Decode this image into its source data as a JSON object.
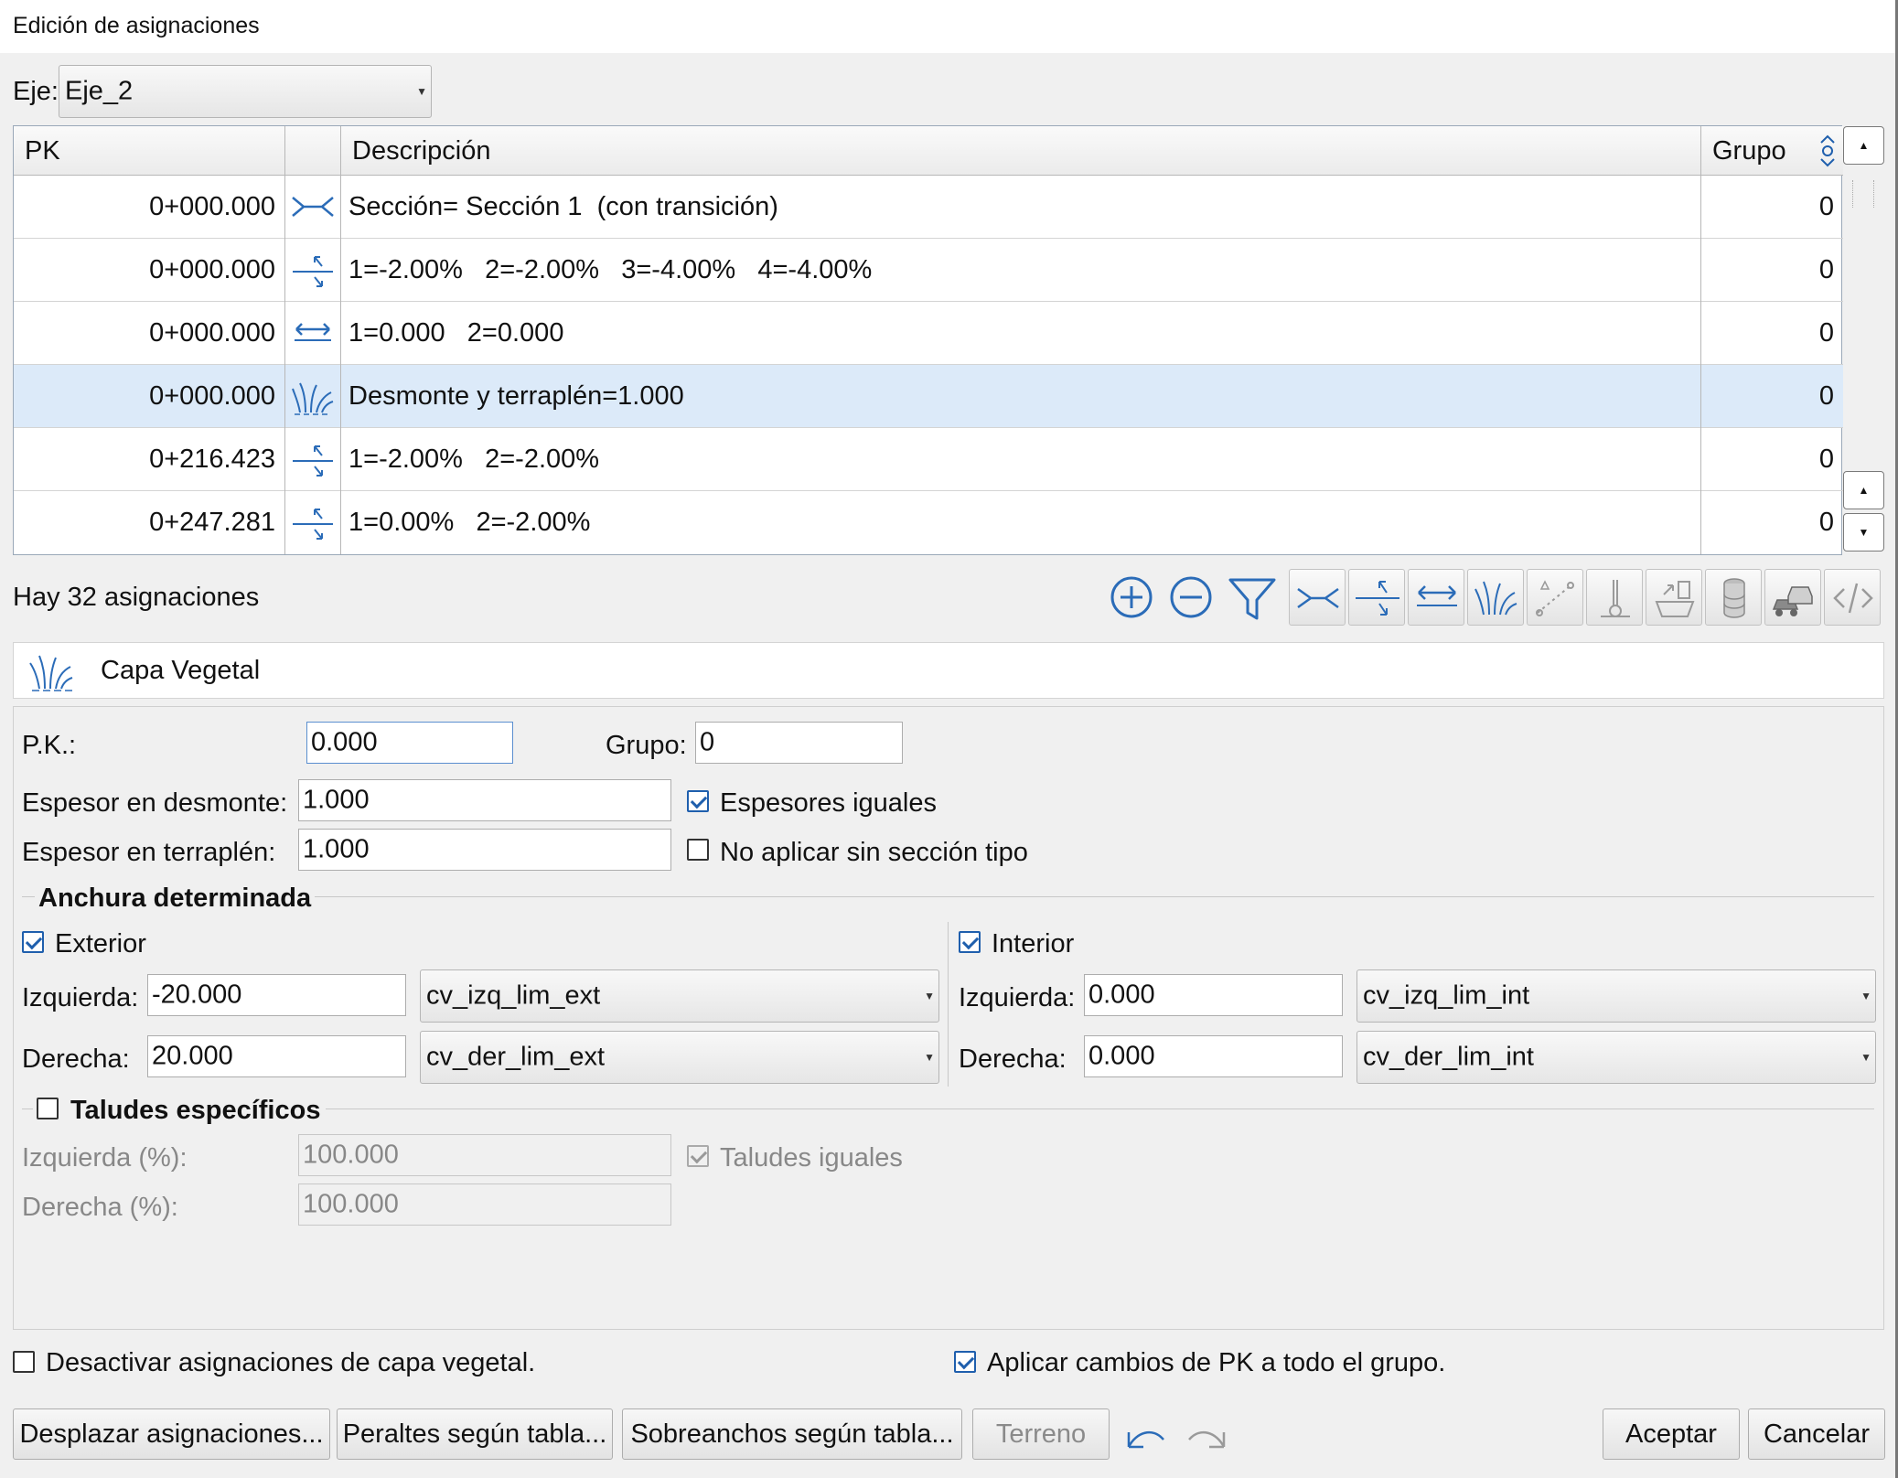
{
  "window": {
    "title": "Edición de asignaciones"
  },
  "axis": {
    "label": "Eje:",
    "value": "Eje_2"
  },
  "table": {
    "headers": {
      "pk": "PK",
      "icon": "",
      "description": "Descripción",
      "group": "Grupo"
    },
    "rows": [
      {
        "pk": "0+000.000",
        "icon": "section-icon",
        "description": "Sección= Sección 1  (con transición)",
        "group": "0"
      },
      {
        "pk": "0+000.000",
        "icon": "superelevation-icon",
        "description": "1=-2.00%   2=-2.00%   3=-4.00%   4=-4.00%",
        "group": "0"
      },
      {
        "pk": "0+000.000",
        "icon": "widening-icon",
        "description": "1=0.000   2=0.000",
        "group": "0"
      },
      {
        "pk": "0+000.000",
        "icon": "vegetation-icon",
        "description": "Desmonte y terraplén=1.000",
        "group": "0",
        "selected": true
      },
      {
        "pk": "0+216.423",
        "icon": "superelevation-icon",
        "description": "1=-2.00%   2=-2.00%",
        "group": "0"
      },
      {
        "pk": "0+247.281",
        "icon": "superelevation-icon",
        "description": "1=0.00%   2=-2.00%",
        "group": "0"
      }
    ]
  },
  "count_text": "Hay 32 asignaciones",
  "toolbar_icons": [
    "add-icon",
    "remove-icon",
    "filter-icon",
    "section-icon",
    "superelevation-icon",
    "widening-icon",
    "vegetation-icon",
    "slope-icon",
    "thermometer-icon",
    "demolition-icon",
    "cylinder-icon",
    "traffic-icon",
    "code-icon"
  ],
  "panel": {
    "title": "Capa Vegetal",
    "pk_label": "P.K.:",
    "pk_value": "0.000",
    "group_label": "Grupo:",
    "group_value": "0",
    "cut_label": "Espesor en desmonte:",
    "cut_value": "1.000",
    "fill_label": "Espesor en terraplén:",
    "fill_value": "1.000",
    "equal_thickness": {
      "label": "Espesores iguales",
      "checked": true
    },
    "no_apply": {
      "label": "No aplicar sin sección tipo",
      "checked": false
    },
    "width_section": "Anchura determinada",
    "exterior": {
      "label": "Exterior",
      "checked": true,
      "left_label": "Izquierda:",
      "left_value": "-20.000",
      "left_combo": "cv_izq_lim_ext",
      "right_label": "Derecha:",
      "right_value": "20.000",
      "right_combo": "cv_der_lim_ext"
    },
    "interior": {
      "label": "Interior",
      "checked": true,
      "left_label": "Izquierda:",
      "left_value": "0.000",
      "left_combo": "cv_izq_lim_int",
      "right_label": "Derecha:",
      "right_value": "0.000",
      "right_combo": "cv_der_lim_int"
    },
    "slopes": {
      "label": "Taludes específicos",
      "checked": false,
      "left_label": "Izquierda (%):",
      "left_value": "100.000",
      "right_label": "Derecha (%):",
      "right_value": "100.000",
      "equal": {
        "label": "Taludes iguales",
        "checked": true
      }
    }
  },
  "deactivate": {
    "label": "Desactivar asignaciones de capa vegetal.",
    "checked": false
  },
  "apply_group": {
    "label": "Aplicar cambios de PK a todo el grupo.",
    "checked": true
  },
  "buttons": {
    "shift": "Desplazar asignaciones...",
    "superelevation": "Peraltes según tabla...",
    "widening": "Sobreanchos según tabla...",
    "terrain": "Terreno",
    "accept": "Aceptar",
    "cancel": "Cancelar"
  },
  "colors": {
    "accent": "#1f5fad",
    "selection": "#dceaf9"
  }
}
